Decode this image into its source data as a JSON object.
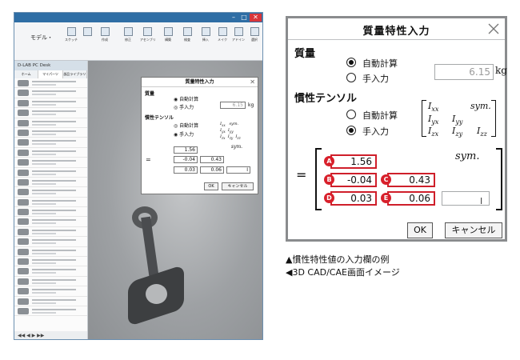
{
  "left_window": {
    "ribbon_tab": "モデル・",
    "ribbon_items": [
      "スケッチ",
      "",
      "作成",
      "修正",
      "アセンブリ",
      "構築",
      "検査",
      "挿入",
      "メイク",
      "アドイン",
      "選択"
    ],
    "sidebar_title": "D-LAB PC Desk",
    "sidebar_tabs": [
      "ホーム",
      "マイパーツ",
      "部品ライブラリ"
    ],
    "mini_dialog": {
      "title": "質量特性入力",
      "mass_label": "質量",
      "auto": "自動計算",
      "manual": "手入力",
      "mass_value": "6.15",
      "unit": "kg",
      "inertia_label": "慣性テンソル",
      "sym": "sym.",
      "equals": "=",
      "v11": "1.56",
      "v21": "-0.04",
      "v22": "0.43",
      "v31": "0.03",
      "v32": "0.06",
      "v33": "I",
      "ok": "OK",
      "cancel": "キャンセル"
    }
  },
  "dialog": {
    "title": "質量特性入力",
    "mass_section": "質量",
    "mass_auto": "自動計算",
    "mass_manual": "手入力",
    "mass_value": "6.15",
    "mass_unit": "kg",
    "inertia_section": "慣性テンソル",
    "inertia_auto": "自動計算",
    "inertia_manual": "手入力",
    "sym": "sym.",
    "equals": "=",
    "ok": "OK",
    "cancel": "キャンセル",
    "cells": [
      {
        "badge": "A",
        "value": "1.56"
      },
      {
        "badge": "B",
        "value": "-0.04"
      },
      {
        "badge": "C",
        "value": "0.43"
      },
      {
        "badge": "D",
        "value": "0.03"
      },
      {
        "badge": "E",
        "value": "0.06"
      }
    ]
  },
  "captions": {
    "line1": "▲慣性特性値の入力欄の例",
    "line2": "◀3D CAD/CAE画面イメージ"
  },
  "colors": {
    "accent_red": "#d8202b",
    "titlebar_blue": "#2f6ea5"
  }
}
